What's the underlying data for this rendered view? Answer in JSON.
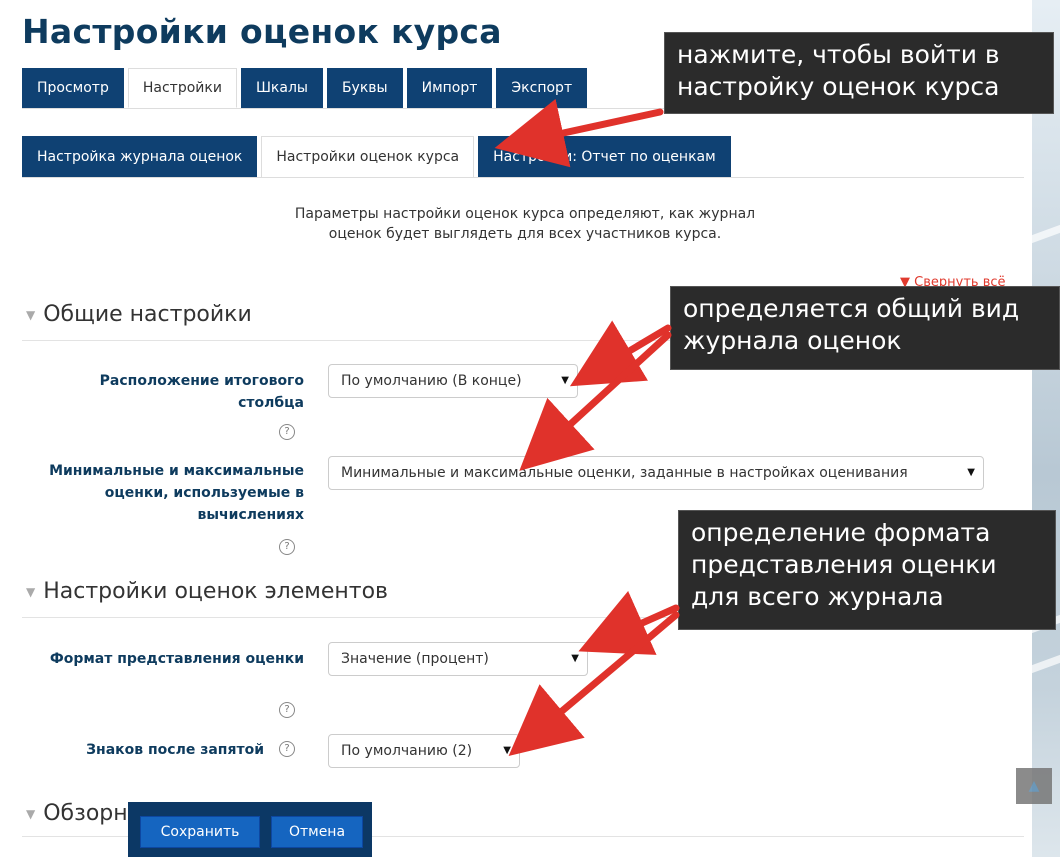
{
  "page_title": "Настройки оценок курса",
  "tabs_primary": [
    {
      "label": "Просмотр",
      "active": false
    },
    {
      "label": "Настройки",
      "active": true
    },
    {
      "label": "Шкалы",
      "active": false
    },
    {
      "label": "Буквы",
      "active": false
    },
    {
      "label": "Импорт",
      "active": false
    },
    {
      "label": "Экспорт",
      "active": false
    }
  ],
  "tabs_secondary": [
    {
      "label": "Настройка журнала оценок",
      "active": false
    },
    {
      "label": "Настройки оценок курса",
      "active": true
    },
    {
      "label": "Настройки: Отчет по оценкам",
      "active": false
    }
  ],
  "intro_text": "Параметры настройки оценок курса определяют, как журнал оценок будет выглядеть для всех участников курса.",
  "collapse_all": "Свернуть всё",
  "sections": {
    "general": "Общие настройки",
    "items": "Настройки оценок элементов",
    "overview": "Обзорн"
  },
  "fields": {
    "aggregation_position": {
      "label": "Расположение итогового столбца",
      "value": "По умолчанию (В конце)"
    },
    "minmax": {
      "label": "Минимальные и максимальные оценки, используемые в вычислениях",
      "value": "Минимальные и максимальные оценки, заданные в настройках оценивания"
    },
    "display_type": {
      "label": "Формат представления оценки",
      "value": "Значение (процент)"
    },
    "decimal_points": {
      "label": "Знаков после запятой",
      "value": "По умолчанию (2)"
    }
  },
  "help_icon": "?",
  "callouts": {
    "enter": "нажмите, чтобы войти в настройку оценок курса",
    "general_view": "определяется общий вид журнала оценок",
    "format": "определение формата представления оценки для всего журнала"
  },
  "buttons": {
    "save": "Сохранить",
    "cancel": "Отмена"
  },
  "colors": {
    "tab_bg": "#0f4173",
    "heading": "#0e3b5e",
    "arrow": "#e0322b",
    "callout_bg": "#2b2b2b",
    "button": "#1565c0"
  }
}
